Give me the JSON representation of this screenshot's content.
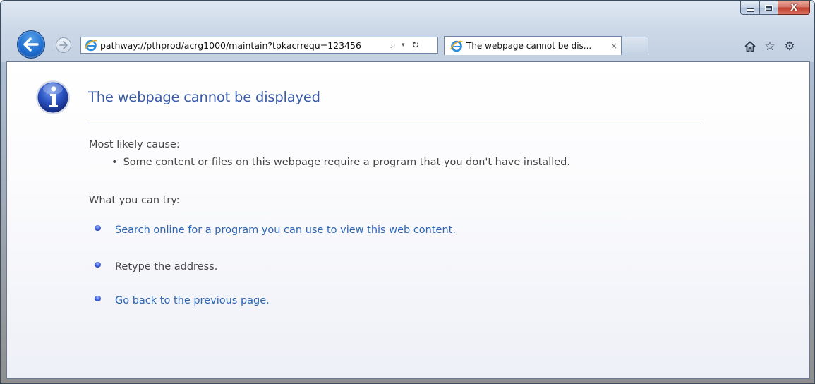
{
  "browser": {
    "address_url": "pathway://pthprod/acrg1000/maintain?tpkacrrequ=123456",
    "tab_title": "The webpage cannot be dis...",
    "tab_close_glyph": "×",
    "window_controls": {
      "close_glyph": "X"
    },
    "icons": {
      "back": "back-arrow-icon",
      "forward": "forward-arrow-icon",
      "search": "search-icon",
      "refresh": "refresh-icon",
      "home": "home-icon",
      "favorites": "star-icon",
      "tools": "gear-icon"
    }
  },
  "page": {
    "title": "The webpage cannot be displayed",
    "cause_heading": "Most likely cause:",
    "causes": [
      "Some content or files on this webpage require a program that you don't have installed."
    ],
    "try_heading": "What you can try:",
    "try_items": [
      {
        "text": "Search online for a program you can use to view this web content.",
        "is_link": true
      },
      {
        "text": "Retype the address.",
        "is_link": false
      },
      {
        "text": "Go back to the previous page.",
        "is_link": true
      }
    ],
    "colors": {
      "title": "#3b5ba8",
      "link": "#2b66b6",
      "body_text": "#444444"
    }
  }
}
